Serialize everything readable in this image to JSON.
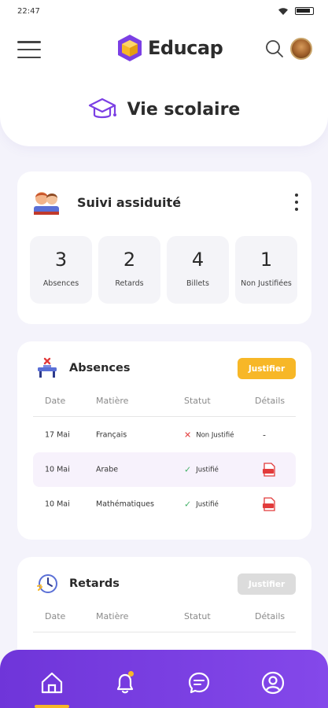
{
  "status_bar": {
    "time": "22:47"
  },
  "header": {
    "app_name": "Educap",
    "page_title": "Vie scolaire"
  },
  "assiduite": {
    "title": "Suivi assiduité",
    "stats": [
      {
        "value": "3",
        "label": "Absences"
      },
      {
        "value": "2",
        "label": "Retards"
      },
      {
        "value": "4",
        "label": "Billets"
      },
      {
        "value": "1",
        "label": "Non Justifiées"
      }
    ]
  },
  "absences": {
    "title": "Absences",
    "justify_label": "Justifier",
    "columns": [
      "Date",
      "Matière",
      "Statut",
      "Détails"
    ],
    "rows": [
      {
        "date": "17 Mai",
        "subject": "Français",
        "status": "Non Justifié",
        "detail": "-"
      },
      {
        "date": "10 Mai",
        "subject": "Arabe",
        "status": "Justifié",
        "detail": "pdf"
      },
      {
        "date": "10 Mai",
        "subject": "Mathématiques",
        "status": "Justifié",
        "detail": "pdf"
      }
    ]
  },
  "retards": {
    "title": "Retards",
    "justify_label": "Justifier",
    "columns": [
      "Date",
      "Matière",
      "Statut",
      "Détails"
    ]
  },
  "colors": {
    "accent": "#7b3fe4",
    "button_yellow": "#f7b727",
    "error": "#e23b3b",
    "success": "#46b36a"
  },
  "icons": {
    "menu": "hamburger-icon",
    "search": "search-icon",
    "graduation": "graduation-cap-icon",
    "more": "kebab-icon",
    "pdf": "pdf-icon",
    "nav": [
      "home-icon",
      "bell-icon",
      "chat-icon",
      "user-icon"
    ]
  }
}
